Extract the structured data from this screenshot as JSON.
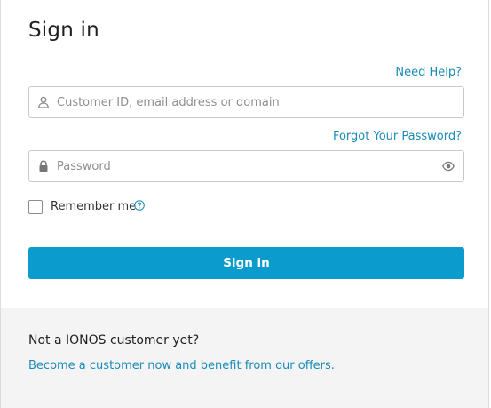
{
  "login": {
    "title": "Sign in",
    "need_help": "Need Help?",
    "username_placeholder": "Customer ID, email address or domain",
    "forgot_password": "Forgot Your Password?",
    "password_placeholder": "Password",
    "remember_label": "Remember me",
    "remember_checked": false,
    "submit_label": "Sign in"
  },
  "footer": {
    "title": "Not a IONOS customer yet?",
    "link": "Become a customer now and benefit from our offers."
  },
  "colors": {
    "accent": "#0b9ccd",
    "link": "#1a8bb7",
    "footer_bg": "#f4f4f4"
  },
  "icons": {
    "username": "user-icon",
    "password": "lock-icon",
    "show_password": "eye-icon",
    "remember_info": "help-circle-icon"
  }
}
